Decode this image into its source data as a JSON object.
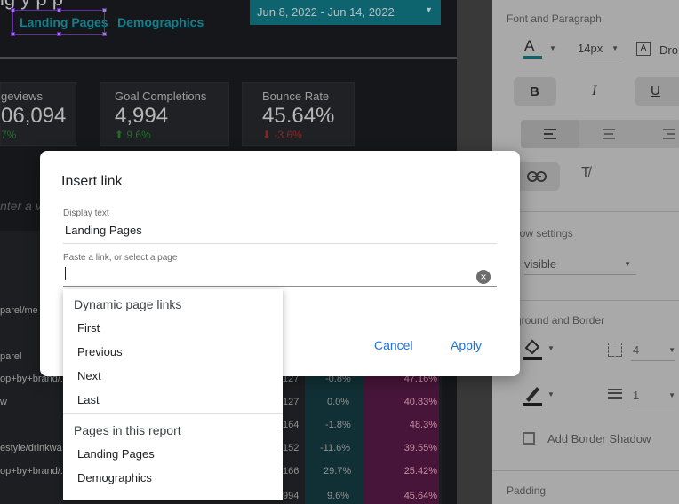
{
  "report": {
    "title_fragment": "ig     y       p   p",
    "page_links": [
      "Landing Pages",
      "Demographics"
    ],
    "date_range": "Jun 8, 2022 - Jun 14, 2022",
    "scorecards": [
      {
        "label": "geviews",
        "value": "06,094",
        "delta": "7%",
        "dir": "up"
      },
      {
        "label": "Goal Completions",
        "value": "4,994",
        "delta": "9.6%",
        "dir": "up"
      },
      {
        "label": "Bounce Rate",
        "value": "45.64%",
        "delta": "-3.6%",
        "dir": "down"
      }
    ],
    "search_placeholder_fragment": "nter a va",
    "table_rows": [
      {
        "label": "parel/me",
        "num": "",
        "pct": "",
        "bounce": ""
      },
      {
        "label": "parel",
        "num": "",
        "pct": "",
        "bounce": ""
      },
      {
        "label": "op+by+brand/.",
        "num": "127",
        "pct": "-0.8%",
        "bounce": "47.16%"
      },
      {
        "label": "w",
        "num": "127",
        "pct": "0.0%",
        "bounce": "40.83%"
      },
      {
        "label": "",
        "num": "164",
        "pct": "-1.8%",
        "bounce": "48.3%"
      },
      {
        "label": "estyle/drinkwa",
        "num": "152",
        "pct": "-11.6%",
        "bounce": "39.55%"
      },
      {
        "label": "op+by+brand/.",
        "num": "166",
        "pct": "29.7%",
        "bounce": "25.42%"
      },
      {
        "label": "",
        "num": "994",
        "pct": "9.6%",
        "bounce": "45.64%"
      }
    ]
  },
  "panel": {
    "font_section": "Font and Paragraph",
    "font_size": "14px",
    "font_family_fragment": "Dro",
    "bold_label": "B",
    "italic_label": "I",
    "underline_label": "U",
    "overflow_section": "erflow settings",
    "overflow_value": "visible",
    "background_section": "ckground and Border",
    "border_radius": "4",
    "border_weight": "1",
    "shadow_label": "Add Border Shadow",
    "padding_section": "Padding"
  },
  "dialog": {
    "title": "Insert link",
    "display_text_label": "Display text",
    "display_text_value": "Landing Pages",
    "link_label": "Paste a link, or select a page",
    "link_value": "",
    "cancel": "Cancel",
    "apply": "Apply"
  },
  "dropdown": {
    "dynamic_header": "Dynamic page links",
    "dynamic_items": [
      "First",
      "Previous",
      "Next",
      "Last"
    ],
    "pages_header": "Pages in this report",
    "pages_items": [
      "Landing Pages",
      "Demographics"
    ]
  },
  "colors": {
    "accent_blue": "#1a73e8",
    "teal": "#13808d",
    "selection_purple": "#7c3cd8"
  }
}
